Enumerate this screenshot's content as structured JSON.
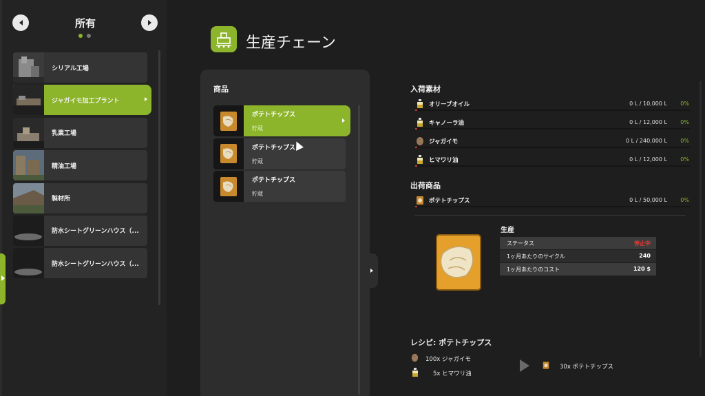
{
  "sidebar": {
    "title": "所有",
    "pager": {
      "current": 1,
      "total": 2
    },
    "items": [
      {
        "label": "シリアル工場",
        "active": false,
        "thumb": "cereal-factory-thumb"
      },
      {
        "label": "ジャガイモ加工プラント",
        "active": true,
        "thumb": "potato-plant-thumb"
      },
      {
        "label": "乳業工場",
        "active": false,
        "thumb": "dairy-thumb"
      },
      {
        "label": "精油工場",
        "active": false,
        "thumb": "oil-mill-thumb"
      },
      {
        "label": "製材所",
        "active": false,
        "thumb": "sawmill-thumb"
      },
      {
        "label": "防水シートグリーンハウス（...",
        "active": false,
        "thumb": "greenhouse-thumb"
      },
      {
        "label": "防水シートグリーンハウス（...",
        "active": false,
        "thumb": "greenhouse-thumb"
      }
    ]
  },
  "header": {
    "title": "生産チェーン",
    "icon": "production-chain-icon"
  },
  "products_panel": {
    "title": "商品",
    "items": [
      {
        "name": "ポテトチップス",
        "sub": "貯蔵",
        "active": true
      },
      {
        "name": "ポテトチップス",
        "sub": "貯蔵",
        "active": false
      },
      {
        "name": "ポテトチップス",
        "sub": "貯蔵",
        "active": false
      }
    ]
  },
  "inputs": {
    "title": "入荷素材",
    "rows": [
      {
        "name": "オリーブオイル",
        "amount": "0 L / 10,000 L",
        "pct": "0%",
        "icon": "oil-bottle-icon"
      },
      {
        "name": "キャノーラ油",
        "amount": "0 L / 12,000 L",
        "pct": "0%",
        "icon": "oil-bottle-icon"
      },
      {
        "name": "ジャガイモ",
        "amount": "0 L / 240,000 L",
        "pct": "0%",
        "icon": "potato-icon"
      },
      {
        "name": "ヒマワリ油",
        "amount": "0 L / 12,000 L",
        "pct": "0%",
        "icon": "oil-bottle-icon"
      }
    ]
  },
  "outputs": {
    "title": "出荷商品",
    "rows": [
      {
        "name": "ポテトチップス",
        "amount": "0 L / 50,000 L",
        "pct": "0%",
        "icon": "chips-bag-icon"
      }
    ]
  },
  "production": {
    "title": "生産",
    "status_label": "ステータス",
    "status_value": "停止中",
    "cycles_label": "1ヶ月あたりのサイクル",
    "cycles_value": "240",
    "cost_label": "1ヶ月あたりのコスト",
    "cost_value": "120 $"
  },
  "recipe": {
    "title": "レシピ: ポテトチップス",
    "inputs": [
      "100x ジャガイモ",
      "5x ヒマワリ油"
    ],
    "output": "30x ポテトチップス"
  },
  "colors": {
    "accent": "#8db52c",
    "warning": "#e53935",
    "bg": "#1e1e1e",
    "panel": "#2d2d2d"
  }
}
